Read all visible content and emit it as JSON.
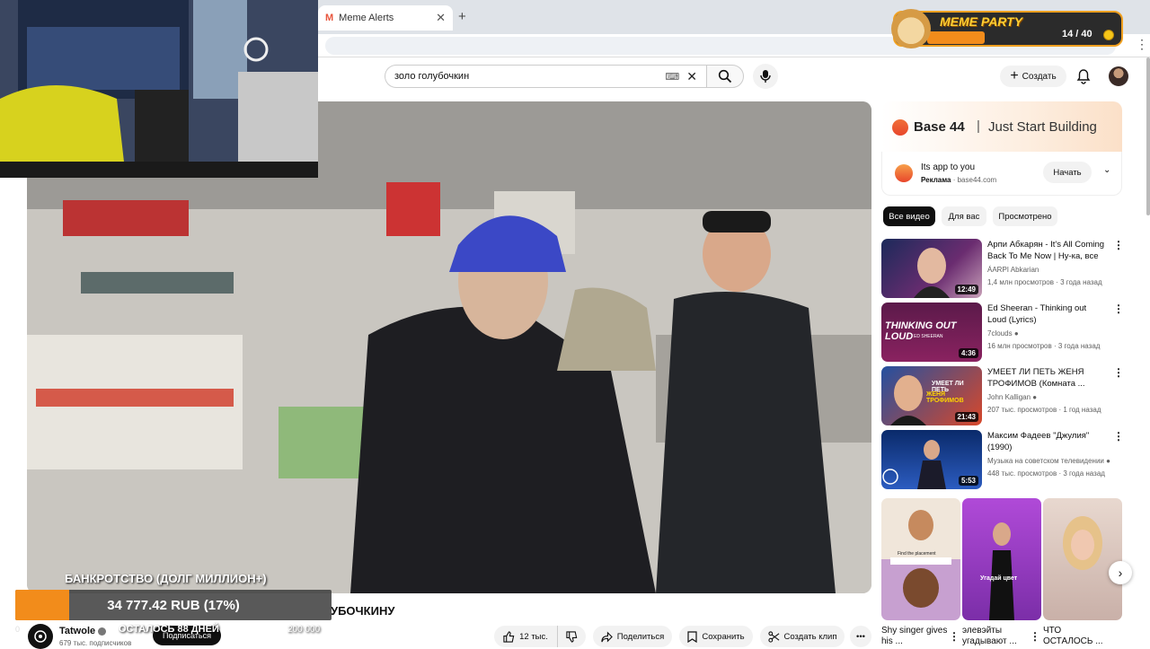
{
  "browser": {
    "tab_title": "Meme Alerts",
    "tab_favicon": "M",
    "new_tab": "+",
    "tab_close": "✕"
  },
  "header": {
    "search_value": "золо голубочкин",
    "create_label": "Создать"
  },
  "video": {
    "title_fragment": "УБОЧКИНУ",
    "channel_name": "Tatwole",
    "subscribers": "679 тыс. подписчиков",
    "subscribe_label": "Подписаться",
    "likes": "12 тыс.",
    "share_label": "Поделиться",
    "save_label": "Сохранить",
    "clip_label": "Создать клип",
    "more_label": "•••"
  },
  "overlay": {
    "debt_title": "БАНКРОТСТВО (ДОЛГ МИЛЛИОН+)",
    "debt_amount": "34 777.42 RUB (17%)",
    "debt_progress": 0.17,
    "days_left": "ОСТАЛОСЬ 88 ДНЕЙ",
    "goal": "200 000",
    "start": "0",
    "meme_title": "MEME PARTY",
    "meme_count": "14 / 40",
    "meme_progress": 0.35
  },
  "ad": {
    "brand": "Base 44",
    "separator": "|",
    "slogan": "Just Start Building",
    "text": "Its app to you",
    "label": "Реклама",
    "domain": "base44.com",
    "button": "Начать"
  },
  "chips": [
    "Все видео",
    "Для вас",
    "Просмотрено"
  ],
  "recommendations": [
    {
      "title": "Арпи Абкарян - It's All Coming Back To Me Now | Ну-ка, все ...",
      "channel": "ÁARPI Abkarian",
      "stats": "1,4 млн просмотров · 3 года назад",
      "duration": "12:49",
      "verified": false
    },
    {
      "title": "Ed Sheeran - Thinking out Loud (Lyrics)",
      "channel": "7clouds",
      "stats": "16 млн просмотров · 3 года назад",
      "duration": "4:36",
      "verified": true,
      "thumb_text": "THINKING OUT LOUD",
      "thumb_sub": "ED SHEERAN"
    },
    {
      "title": "УМЕЕТ ЛИ ПЕТЬ ЖЕНЯ ТРОФИМОВ (Комната ...",
      "channel": "John Kalligan",
      "stats": "207 тыс. просмотров · 1 год назад",
      "duration": "21:43",
      "verified": true,
      "thumb_text": "УМЕЕТ ЛИ ПЕТЬ",
      "thumb_sub": "ЖЕНЯ ТРОФИМОВ"
    },
    {
      "title": "Максим Фадеев \"Джулия\" (1990)",
      "channel": "Музыка на советском телевидении",
      "stats": "448 тыс. просмотров · 3 года назад",
      "duration": "5:53",
      "verified": true
    }
  ],
  "shorts": [
    {
      "caption": "Shy singer gives his ...",
      "overlay": "Find the placement"
    },
    {
      "caption": "элевэйты угадывают ...",
      "overlay": "Угадай цвет"
    },
    {
      "caption": "ЧТО ОСТАЛОСЬ ...",
      "overlay": ""
    }
  ],
  "colors": {
    "accent": "#f28c1b",
    "brand": "#e8462b"
  }
}
